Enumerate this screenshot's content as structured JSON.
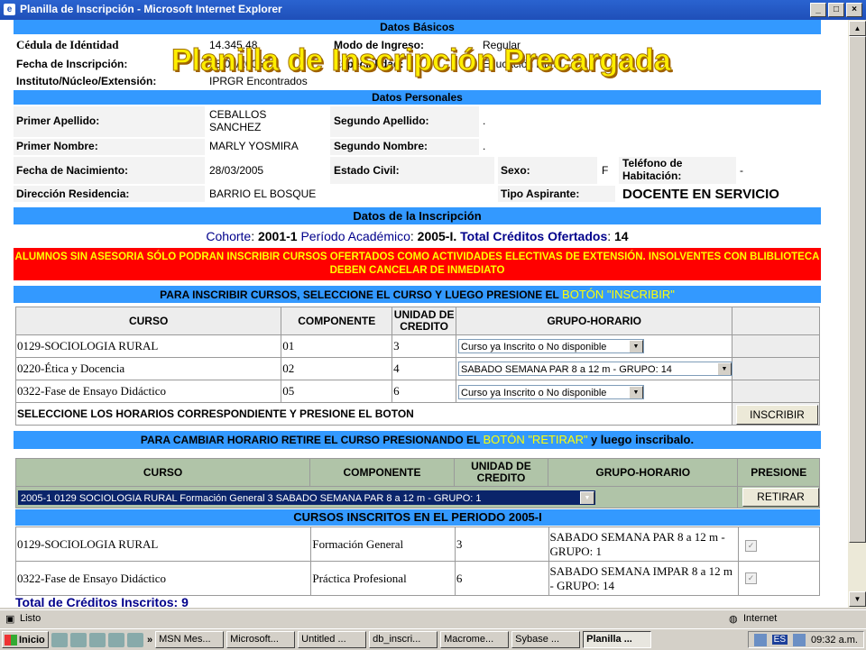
{
  "window": {
    "title": "Planilla de Inscripción - Microsoft Internet Explorer"
  },
  "overlay_title": "Planilla de Inscripción Precargada",
  "datos_basicos": {
    "header": "Datos Básicos",
    "cedula_label": "Cédula de Idéntidad",
    "cedula_value": "14.345.48",
    "modo_label": "Modo de Ingreso:",
    "modo_value": "Regular",
    "fecha_label": "Fecha de Inscripción:",
    "fecha_value": "28/03/2005",
    "especialidad_label": "Especialidad:",
    "especialidad_value": "Educación Rural",
    "instituto_label": "Instituto/Núcleo/Extensión:",
    "instituto_value": "IPRGR Encontrados"
  },
  "datos_personales": {
    "header": "Datos Personales",
    "primer_apellido_label": "Primer Apellido:",
    "primer_apellido_value": "CEBALLOS SANCHEZ",
    "segundo_apellido_label": "Segundo Apellido:",
    "segundo_apellido_value": ".",
    "primer_nombre_label": "Primer Nombre:",
    "primer_nombre_value": "MARLY YOSMIRA",
    "segundo_nombre_label": "Segundo Nombre:",
    "segundo_nombre_value": ".",
    "nacimiento_label": "Fecha de Nacimiento:",
    "nacimiento_value": "28/03/2005",
    "civil_label": "Estado Civil:",
    "sexo_label": "Sexo:",
    "sexo_value": "F",
    "telefono_label": "Teléfono de Habitación:",
    "telefono_value": "-",
    "direccion_label": "Dirección Residencia:",
    "direccion_value": "BARRIO EL BOSQUE",
    "tipo_label": "Tipo Aspirante:",
    "tipo_value": "DOCENTE EN SERVICIO"
  },
  "inscripcion": {
    "header": "Datos de la Inscripción",
    "cohorte_label": "Cohorte",
    "cohorte_value": "2001-1",
    "periodo_label": "Período Académico",
    "periodo_value": "2005-I.",
    "creditos_label": "Total Créditos Ofertados",
    "creditos_value": "14",
    "warning": "ALUMNOS SIN ASESORIA SÓLO PODRAN INSCRIBIR CURSOS OFERTADOS COMO ACTIVIDADES ELECTIVAS DE EXTENSIÓN. INSOLVENTES CON BLIBLIOTECA DEBEN CANCELAR DE INMEDIATO",
    "instr_text": "PARA INSCRIBIR CURSOS, SELECCIONE EL CURSO Y LUEGO PRESIONE EL",
    "instr_highlight": "BOTÓN \"INSCRIBIR\"",
    "col_curso": "CURSO",
    "col_componente": "COMPONENTE",
    "col_unidad": "UNIDAD DE CREDITO",
    "col_grupo": "GRUPO-HORARIO",
    "rows": [
      {
        "curso": "0129-SOCIOLOGIA RURAL",
        "componente": "01",
        "unidad": "3",
        "grupo": "Curso ya Inscrito o No disponible"
      },
      {
        "curso": "0220-Ética y Docencia",
        "componente": "02",
        "unidad": "4",
        "grupo": "SABADO SEMANA PAR 8 a 12 m - GRUPO: 14"
      },
      {
        "curso": "0322-Fase de Ensayo Didáctico",
        "componente": "05",
        "unidad": "6",
        "grupo": "Curso ya Inscrito o No disponible"
      }
    ],
    "seleccione_text": "SELECCIONE LOS HORARIOS CORRESPONDIENTE Y PRESIONE EL BOTON",
    "inscribir_button": "INSCRIBIR"
  },
  "retiro": {
    "instr_text": "PARA CAMBIAR HORARIO RETIRE EL CURSO PRESIONANDO EL",
    "instr_highlight": "BOTÓN \"RETIRAR\"",
    "instr_tail": "y luego inscribalo.",
    "col_curso": "CURSO",
    "col_componente": "COMPONENTE",
    "col_unidad": "UNIDAD DE CREDITO",
    "col_grupo": "GRUPO-HORARIO",
    "col_presione": "PRESIONE",
    "select_value": "2005-1 0129 SOCIOLOGIA RURAL Formación General 3 SABADO SEMANA PAR 8 a 12 m - GRUPO: 1",
    "retirar_button": "RETIRAR"
  },
  "inscritos": {
    "header": "CURSOS INSCRITOS EN EL PERIODO 2005-I",
    "rows": [
      {
        "curso": "0129-SOCIOLOGIA RURAL",
        "componente": "Formación General",
        "unidad": "3",
        "grupo": "SABADO SEMANA PAR 8 a 12 m - GRUPO: 1"
      },
      {
        "curso": "0322-Fase de Ensayo Didáctico",
        "componente": "Práctica Profesional",
        "unidad": "6",
        "grupo": "SABADO SEMANA IMPAR 8 a 12 m - GRUPO: 14"
      }
    ],
    "total_label": "Total de Créditos Inscritos:",
    "total_value": "9"
  },
  "statusbar": {
    "status": "Listo",
    "zone": "Internet"
  },
  "taskbar": {
    "start": "Inicio",
    "items": [
      "MSN Mes...",
      "Microsoft...",
      "Untitled ...",
      "db_inscri...",
      "Macrome...",
      "Sybase ...",
      "Planilla ..."
    ],
    "lang": "ES",
    "clock": "09:32 a.m."
  },
  "colors": {
    "section_bar": "#3399ff",
    "warning_bg": "#ff0000",
    "highlight": "#ffff00",
    "title_bar": "#1f4fb8"
  }
}
